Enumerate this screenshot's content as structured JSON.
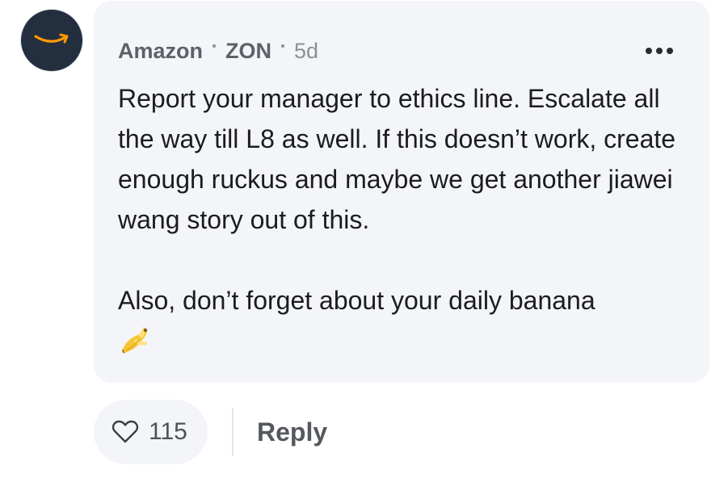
{
  "comment": {
    "avatar_icon": "amazon-smile-logo",
    "company": "Amazon",
    "username": "ZON",
    "age": "5d",
    "more_icon": "ellipsis-icon",
    "paragraph_1": "Report your manager to ethics line. Escalate all the way till L8 as well. If this doesn’t work, create enough ruckus and maybe we get another jiawei wang story out of this.",
    "paragraph_2": "Also, don’t forget about your daily banana",
    "emoji_icon": "banana-emoji"
  },
  "actions": {
    "like_icon": "heart-outline-icon",
    "like_count": "115",
    "reply_label": "Reply"
  },
  "colors": {
    "bubble_bg": "#f4f5f8",
    "avatar_bg": "#232f3e",
    "amazon_orange": "#ff9900"
  }
}
